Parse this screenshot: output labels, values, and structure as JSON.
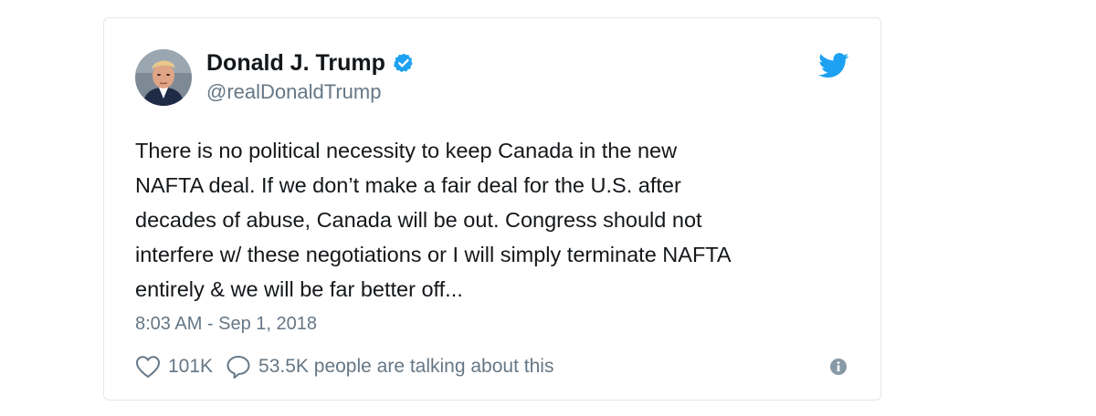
{
  "tweet": {
    "author": {
      "display_name": "Donald J. Trump",
      "handle": "@realDonaldTrump",
      "verified": true
    },
    "text": "There is no political necessity to keep Canada in the new\nNAFTA deal. If we don’t make a fair deal for the U.S. after\ndecades of abuse, Canada will be out. Congress should not\ninterfere w/ these negotiations or I will simply terminate NAFTA\nentirely & we will be far better off...",
    "timestamp": "8:03 AM - Sep 1, 2018",
    "likes": "101K",
    "talking": "53.5K people are talking about this"
  },
  "icons": {
    "like": "heart-icon",
    "reply": "speech-bubble-icon",
    "info": "info-icon",
    "brand": "twitter-bird-icon",
    "verified": "verified-badge-icon"
  },
  "colors": {
    "brand_blue": "#1da1f2",
    "secondary_text": "#657786",
    "primary_text": "#14171a",
    "border": "#e1e8ed"
  }
}
